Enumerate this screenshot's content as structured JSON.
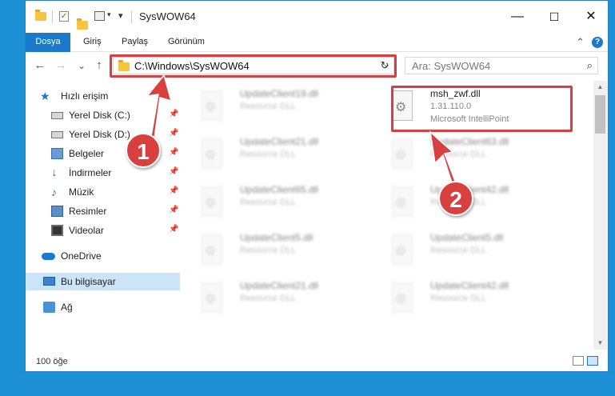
{
  "window": {
    "title": "SysWOW64",
    "min_glyph": "—",
    "max_glyph": "☐",
    "close_glyph": "✕"
  },
  "ribbon": {
    "tabs": [
      {
        "label": "Dosya"
      },
      {
        "label": "Giriş"
      },
      {
        "label": "Paylaş"
      },
      {
        "label": "Görünüm"
      }
    ],
    "expand_glyph": "⌃",
    "help_glyph": "?"
  },
  "nav": {
    "back_glyph": "←",
    "forward_glyph": "→",
    "recent_glyph": "⌄",
    "up_glyph": "↑",
    "address": "C:\\Windows\\SysWOW64",
    "refresh_glyph": "↻",
    "search_placeholder": "Ara: SysWOW64",
    "search_glyph": "⌕"
  },
  "sidebar": {
    "items": [
      {
        "label": "Hızlı erişim",
        "icon": "star-icon"
      },
      {
        "label": "Yerel Disk (C:)",
        "icon": "disk-icon",
        "pinned": true
      },
      {
        "label": "Yerel Disk (D:)",
        "icon": "disk-icon",
        "pinned": true
      },
      {
        "label": "Belgeler",
        "icon": "documents-icon",
        "pinned": true
      },
      {
        "label": "İndirmeler",
        "icon": "download-icon",
        "pinned": true
      },
      {
        "label": "Müzik",
        "icon": "music-icon",
        "pinned": true
      },
      {
        "label": "Resimler",
        "icon": "pictures-icon",
        "pinned": true
      },
      {
        "label": "Videolar",
        "icon": "videos-icon",
        "pinned": true
      },
      {
        "label": "OneDrive",
        "icon": "cloud-icon"
      },
      {
        "label": "Bu bilgisayar",
        "icon": "computer-icon",
        "selected": true
      },
      {
        "label": "Ağ",
        "icon": "network-icon"
      }
    ],
    "pin_glyph": "📌"
  },
  "files": {
    "highlighted": {
      "name": "msh_zwf.dll",
      "version": "1.31.110.0",
      "company": "Microsoft IntelliPoint"
    },
    "left_column": [
      {
        "name": "UpdateClient19.dll",
        "type": "Resource DLL"
      },
      {
        "name": "UpdateClient21.dll",
        "type": "Resource DLL"
      },
      {
        "name": "UpdateClient65.dll",
        "type": "Resource DLL"
      },
      {
        "name": "UpdateClient5.dll",
        "type": "Resource DLL"
      },
      {
        "name": "UpdateClient21.dll",
        "type": "Resource DLL"
      }
    ],
    "right_column": [
      {
        "name": "UpdateClient63.dll",
        "type": "Resource DLL"
      },
      {
        "name": "UpdateClient42.dll",
        "type": "Resource DLL"
      },
      {
        "name": "UpdateClient5.dll",
        "type": "Resource DLL"
      },
      {
        "name": "UpdateClient42.dll",
        "type": "Resource DLL"
      }
    ]
  },
  "status": {
    "count": "100 öğe"
  },
  "annotations": {
    "step1": "1",
    "step2": "2",
    "color": "#d84040"
  }
}
